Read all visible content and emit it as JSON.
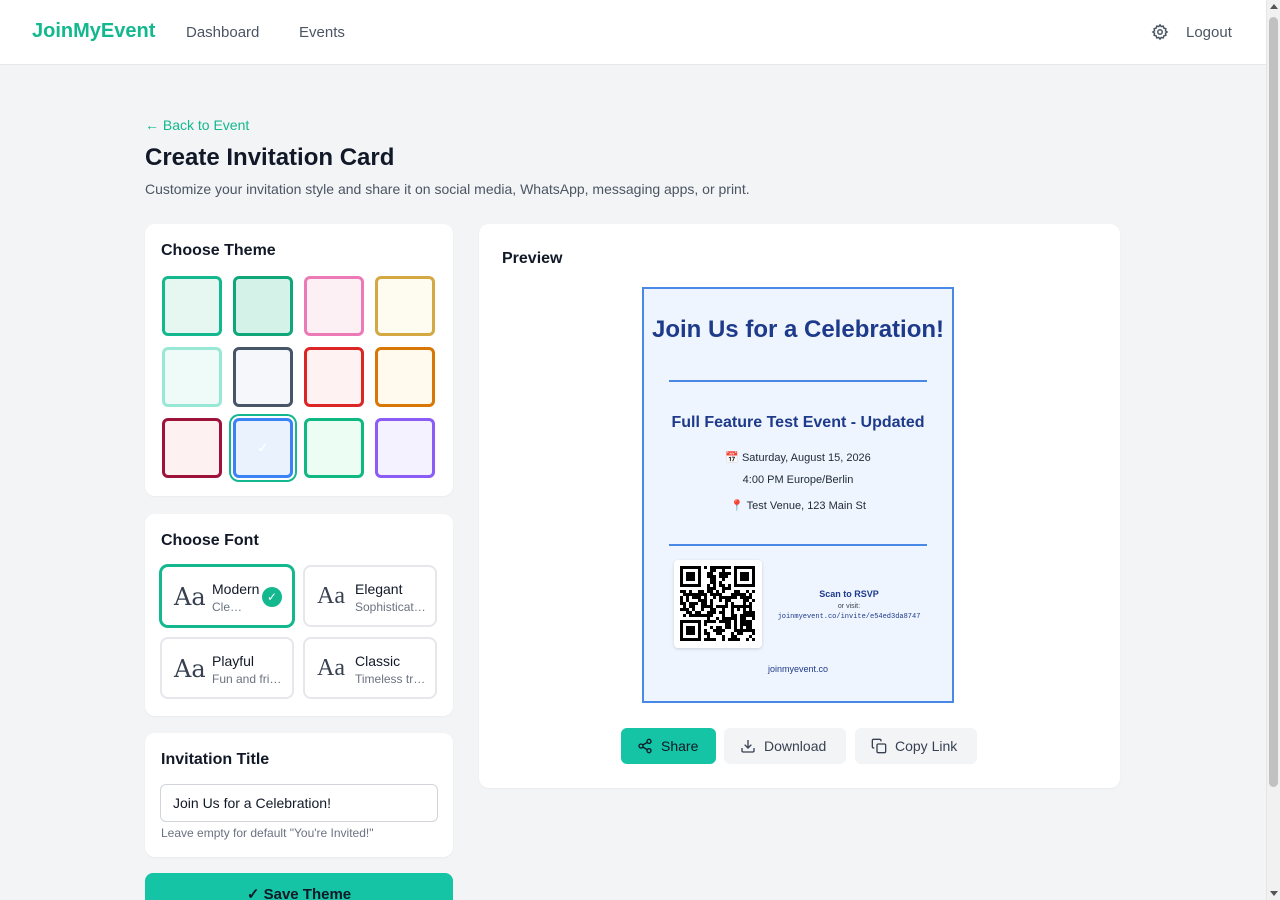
{
  "nav": {
    "brand": "JoinMyEvent",
    "links": [
      "Dashboard",
      "Events"
    ],
    "logout": "Logout"
  },
  "header": {
    "back": "← Back to Event",
    "title": "Create Invitation Card",
    "subtitle": "Customize your invitation style and share it on social media, WhatsApp, messaging apps, or print."
  },
  "theme": {
    "title": "Choose Theme",
    "selected_index": 9,
    "swatches": [
      {
        "bg": "#e6f7f1",
        "border": "#14b88f"
      },
      {
        "bg": "#d5f2e9",
        "border": "#0fa77a"
      },
      {
        "bg": "#fdf0f5",
        "border": "#ec7ab6"
      },
      {
        "bg": "#fefbf0",
        "border": "#d4a843"
      },
      {
        "bg": "#eefbf8",
        "border": "#99e8d6"
      },
      {
        "bg": "#f6f7fa",
        "border": "#475569"
      },
      {
        "bg": "#fef2f2",
        "border": "#dc2626"
      },
      {
        "bg": "#fffaed",
        "border": "#d97706"
      },
      {
        "bg": "#fdf1f2",
        "border": "#9f1239"
      },
      {
        "bg": "#eaf2fe",
        "border": "#3b82f6"
      },
      {
        "bg": "#ecfdf3",
        "border": "#10b981"
      },
      {
        "bg": "#f4f2fe",
        "border": "#8b5cf6"
      }
    ]
  },
  "font": {
    "title": "Choose Font",
    "options": [
      {
        "aa": "Aa",
        "name": "Modern",
        "desc": "Clean and modern",
        "selected": true
      },
      {
        "aa": "Aa",
        "name": "Elegant",
        "desc": "Sophisticated serif",
        "selected": false
      },
      {
        "aa": "Aa",
        "name": "Playful",
        "desc": "Fun and friendly",
        "selected": false
      },
      {
        "aa": "Aa",
        "name": "Classic",
        "desc": "Timeless traditional",
        "selected": false
      }
    ]
  },
  "invitation": {
    "title": "Invitation Title",
    "value": "Join Us for a Celebration!",
    "help": "Leave empty for default \"You're Invited!\""
  },
  "save_label": "Save Theme",
  "preview": {
    "title": "Preview",
    "card_title": "Join Us for a Celebration!",
    "event_name": "Full Feature Test Event - Updated",
    "date": "📅 Saturday, August 15, 2026",
    "time": "4:00 PM Europe/Berlin",
    "venue": "📍 Test Venue, 123 Main St",
    "scan": "Scan to RSVP",
    "or_visit": "or visit:",
    "url": "joinmyevent.co/invite/e54ed3da8747",
    "footer": "joinmyevent.co"
  },
  "actions": {
    "share": "Share",
    "download": "Download",
    "copy": "Copy Link"
  },
  "colors": {
    "accent": "#14b88f",
    "card_border": "#4a88e8",
    "card_bg": "#eef5fe",
    "card_text": "#1e3a8a"
  }
}
